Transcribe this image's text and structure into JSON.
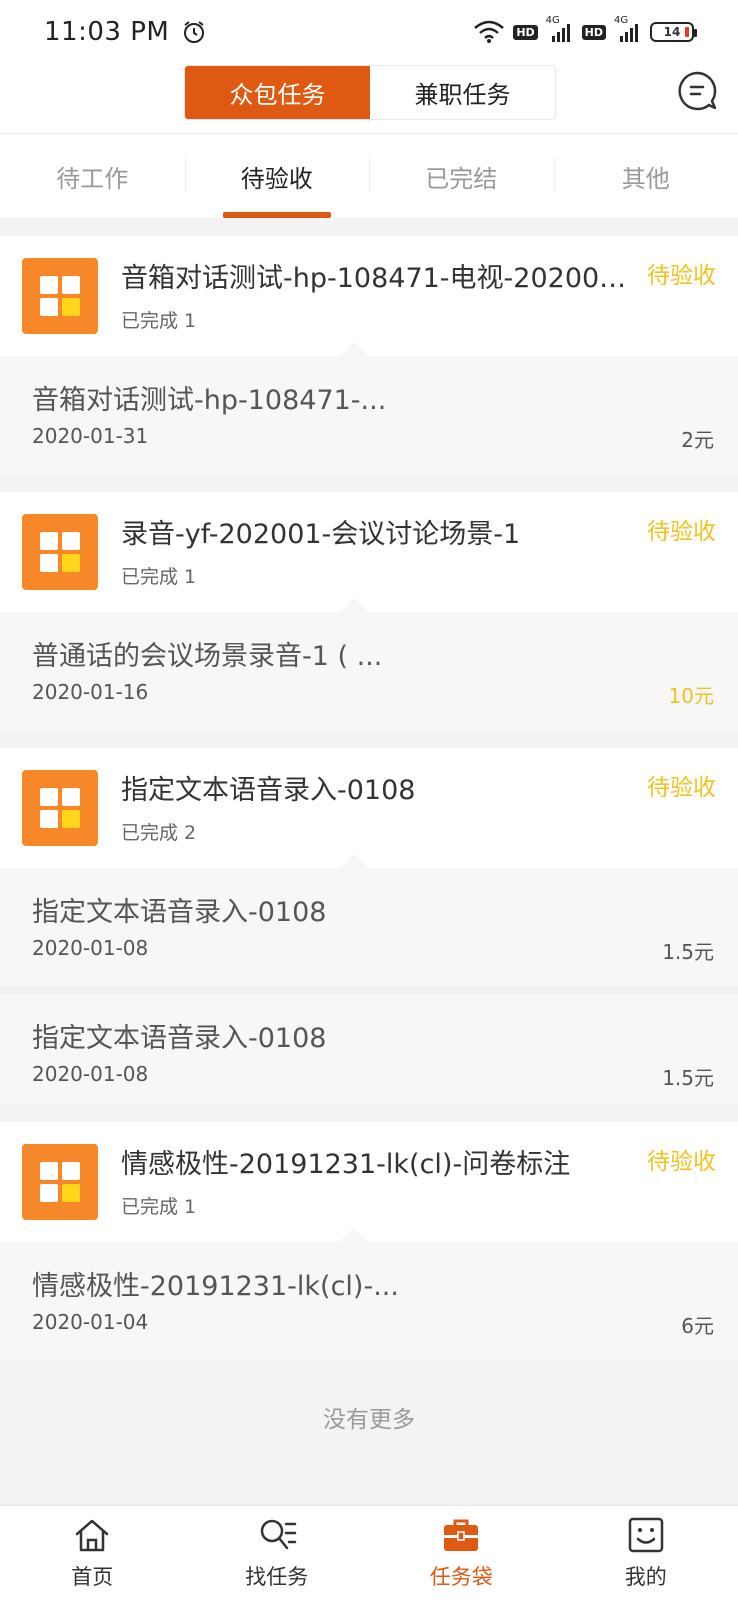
{
  "status_bar": {
    "time": "11:03 PM",
    "hd1": "HD",
    "net1": "4G",
    "hd2": "HD",
    "net2": "4G",
    "battery": "14"
  },
  "header": {
    "segment_active": "众包任务",
    "segment_inactive": "兼职任务"
  },
  "tabs": [
    {
      "label": "待工作"
    },
    {
      "label": "待验收"
    },
    {
      "label": "已完结"
    },
    {
      "label": "其他"
    }
  ],
  "tasks": [
    {
      "title": "音箱对话测试-hp-108471-电视-20200…",
      "status": "待验收",
      "completed": "已完成 1",
      "items": [
        {
          "title": "音箱对话测试-hp-108471-...",
          "date": "2020-01-31",
          "price": "2元"
        }
      ]
    },
    {
      "title": "录音-yf-202001-会议讨论场景-1",
      "status": "待验收",
      "completed": "已完成 1",
      "items": [
        {
          "title": "普通话的会议场景录音-1 ( ...",
          "date": "2020-01-16",
          "price": "10元"
        }
      ]
    },
    {
      "title": "指定文本语音录入-0108",
      "status": "待验收",
      "completed": "已完成 2",
      "items": [
        {
          "title": "指定文本语音录入-0108",
          "date": "2020-01-08",
          "price": "1.5元"
        },
        {
          "title": "指定文本语音录入-0108",
          "date": "2020-01-08",
          "price": "1.5元"
        }
      ]
    },
    {
      "title": "情感极性-20191231-lk(cl)-问卷标注",
      "status": "待验收",
      "completed": "已完成 1",
      "items": [
        {
          "title": "情感极性-20191231-lk(cl)-...",
          "date": "2020-01-04",
          "price": "6元"
        }
      ]
    }
  ],
  "footer": {
    "no_more": "没有更多"
  },
  "bottom_nav": [
    {
      "label": "首页"
    },
    {
      "label": "找任务"
    },
    {
      "label": "任务袋"
    },
    {
      "label": "我的"
    }
  ],
  "colors": {
    "accent": "#de5a12",
    "status": "#f3c21c",
    "app_icon": "#f7882a"
  }
}
